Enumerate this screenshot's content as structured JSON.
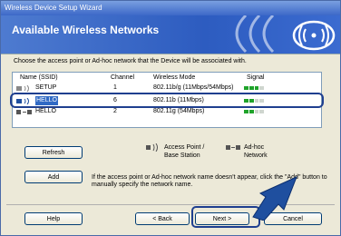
{
  "window": {
    "title": "Wireless Device Setup Wizard"
  },
  "header": {
    "title": "Available Wireless Networks"
  },
  "instruction": "Choose the access point or Ad-hoc network that the Device will be associated with.",
  "list": {
    "columns": [
      "Name (SSID)",
      "Channel",
      "Wireless Mode",
      "Signal"
    ],
    "rows": [
      {
        "ssid": "SETUP",
        "channel": "1",
        "mode": "802.11b/g (11Mbps/54Mbps)",
        "signal": 0.75,
        "selected": false
      },
      {
        "ssid": "HELLO",
        "channel": "6",
        "mode": "802.11b (11Mbps)",
        "signal": 0.5,
        "selected": true
      },
      {
        "ssid": "HELLO",
        "channel": "2",
        "mode": "802.11g (54Mbps)",
        "signal": 0.5,
        "selected": false
      }
    ]
  },
  "buttons": {
    "refresh": "Refresh",
    "add": "Add",
    "help": "Help",
    "back": "< Back",
    "next": "Next >",
    "cancel": "Cancel"
  },
  "legend": {
    "access_point": "Access Point / Base Station",
    "adhoc": "Ad-hoc Network"
  },
  "note": "If the access point or Ad-hoc network name doesn't appear, click the \"Add\" button to manually specify the network name.",
  "colors": {
    "selection": "#316ac5",
    "highlight_ring": "#1f3f8f",
    "arrow": "#1f4f9f",
    "signal_on": "#1fa32a"
  },
  "icons": [
    "wireless-logo-icon",
    "access-point-icon",
    "adhoc-icon",
    "pointer-arrow-icon"
  ]
}
